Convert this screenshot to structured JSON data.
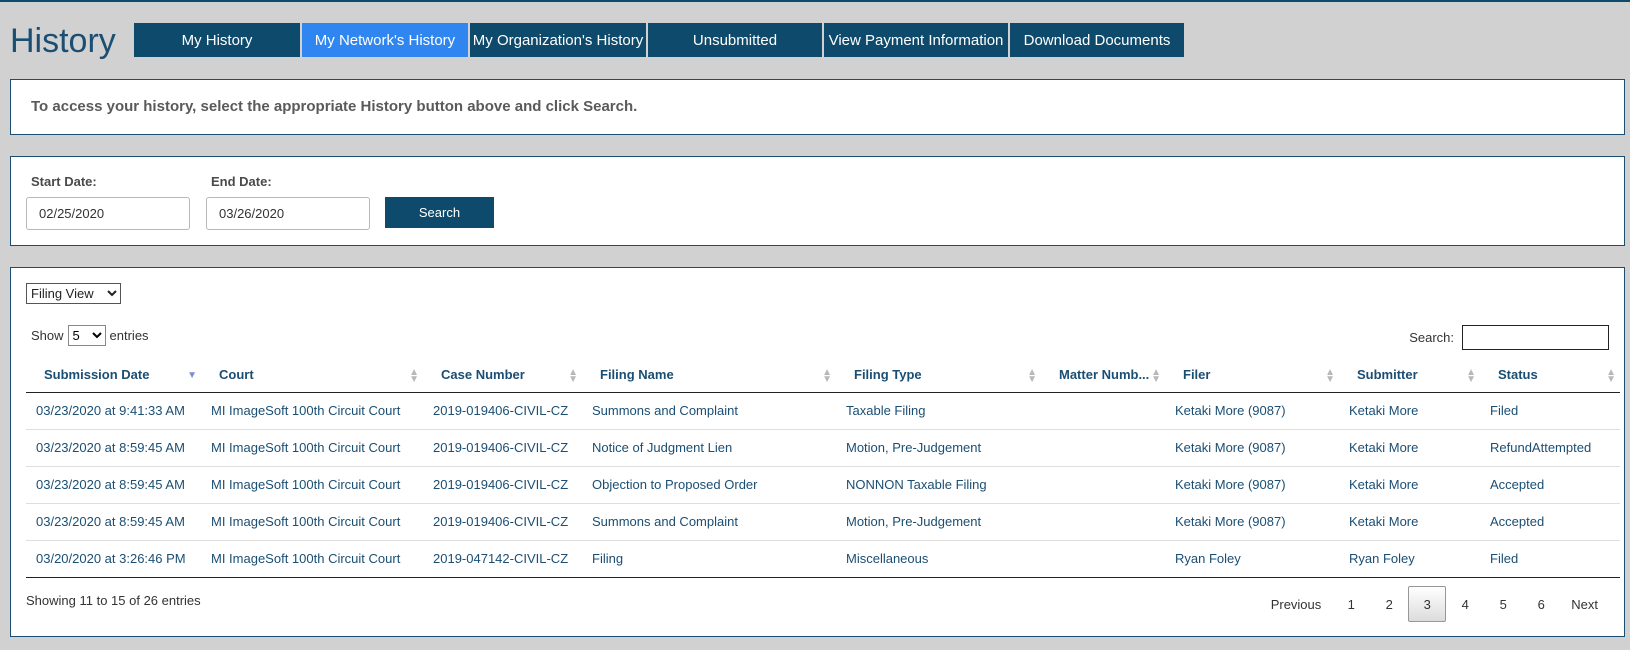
{
  "header": {
    "title": "History",
    "tabs": [
      {
        "label": "My History",
        "active": false
      },
      {
        "label": "My Network's History",
        "active": true
      },
      {
        "label": "My Organization's History",
        "active": false
      },
      {
        "label": "Unsubmitted",
        "active": false
      },
      {
        "label": "View Payment Information",
        "active": false
      },
      {
        "label": "Download Documents",
        "active": false
      }
    ]
  },
  "notice": {
    "text": "To access your history, select the appropriate History button above and click Search."
  },
  "search_form": {
    "start_label": "Start Date:",
    "start_value": "02/25/2020",
    "end_label": "End Date:",
    "end_value": "03/26/2020",
    "search_label": "Search"
  },
  "table_controls": {
    "view_selected": "Filing View",
    "show_label": "Show",
    "show_value": "5",
    "entries_label": "entries",
    "search_label": "Search:"
  },
  "table": {
    "columns": [
      "Submission Date",
      "Court",
      "Case Number",
      "Filing Name",
      "Filing Type",
      "Matter Numb...",
      "Filer",
      "Submitter",
      "Status"
    ],
    "rows": [
      [
        "03/23/2020 at 9:41:33 AM",
        "MI ImageSoft 100th Circuit Court",
        "2019-019406-CIVIL-CZ",
        "Summons and Complaint",
        "Taxable Filing",
        "",
        "Ketaki More (9087)",
        "Ketaki More",
        "Filed"
      ],
      [
        "03/23/2020 at 8:59:45 AM",
        "MI ImageSoft 100th Circuit Court",
        "2019-019406-CIVIL-CZ",
        "Notice of Judgment Lien",
        "Motion, Pre-Judgement",
        "",
        "Ketaki More (9087)",
        "Ketaki More",
        "RefundAttempted"
      ],
      [
        "03/23/2020 at 8:59:45 AM",
        "MI ImageSoft 100th Circuit Court",
        "2019-019406-CIVIL-CZ",
        "Objection to Proposed Order",
        "NONNON Taxable Filing",
        "",
        "Ketaki More (9087)",
        "Ketaki More",
        "Accepted"
      ],
      [
        "03/23/2020 at 8:59:45 AM",
        "MI ImageSoft 100th Circuit Court",
        "2019-019406-CIVIL-CZ",
        "Summons and Complaint",
        "Motion, Pre-Judgement",
        "",
        "Ketaki More (9087)",
        "Ketaki More",
        "Accepted"
      ],
      [
        "03/20/2020 at 3:26:46 PM",
        "MI ImageSoft 100th Circuit Court",
        "2019-047142-CIVIL-CZ",
        "Filing",
        "Miscellaneous",
        "",
        "Ryan Foley",
        "Ryan Foley",
        "Filed"
      ]
    ],
    "sorted_column": "Submission Date"
  },
  "footer": {
    "info": "Showing 11 to 15 of 26 entries",
    "previous_label": "Previous",
    "next_label": "Next",
    "pages": [
      "1",
      "2",
      "3",
      "4",
      "5",
      "6"
    ],
    "current_page": "3"
  },
  "colors": {
    "tab_bg": "#0e4a6b",
    "tab_active_bg": "#2f86f0",
    "page_bg": "#d1d1d1",
    "text_blue": "#1b4e73"
  }
}
